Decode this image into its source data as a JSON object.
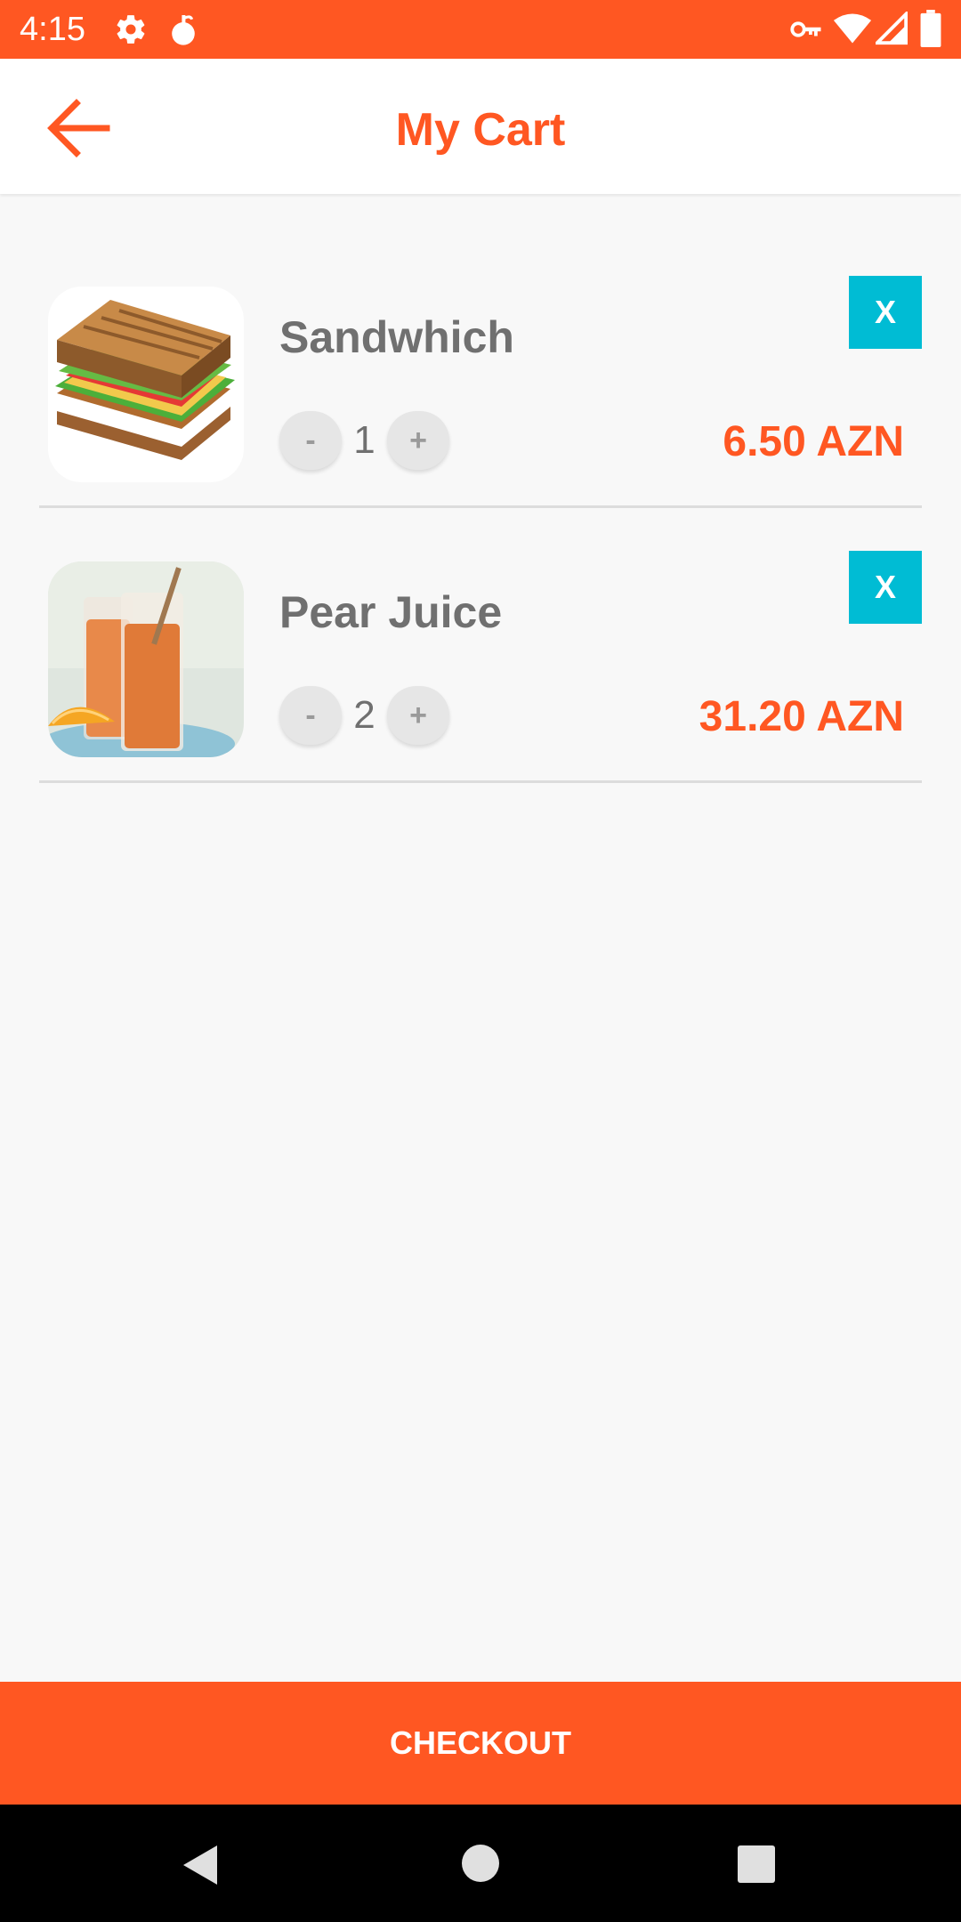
{
  "status_bar": {
    "time": "4:15",
    "left_icons": [
      "settings-icon",
      "notification-icon"
    ],
    "right_icons": [
      "vpn-key-icon",
      "wifi-icon",
      "signal-icon",
      "battery-icon"
    ]
  },
  "app_bar": {
    "title": "My Cart",
    "back_icon": "arrow-back-icon"
  },
  "cart": {
    "items": [
      {
        "name": "Sandwhich",
        "quantity": "1",
        "price": "6.50 AZN",
        "minus": "-",
        "plus": "+",
        "remove": "X"
      },
      {
        "name": "Pear Juice",
        "quantity": "2",
        "price": "31.20 AZN",
        "minus": "-",
        "plus": "+",
        "remove": "X"
      }
    ]
  },
  "checkout": {
    "label": "CHECKOUT"
  },
  "nav_bar": {
    "icons": [
      "back-icon",
      "home-icon",
      "recents-icon"
    ]
  },
  "colors": {
    "accent": "#ff5722",
    "remove_button": "#00bcd4",
    "text_gray": "#707070",
    "background": "#f8f8f8"
  }
}
